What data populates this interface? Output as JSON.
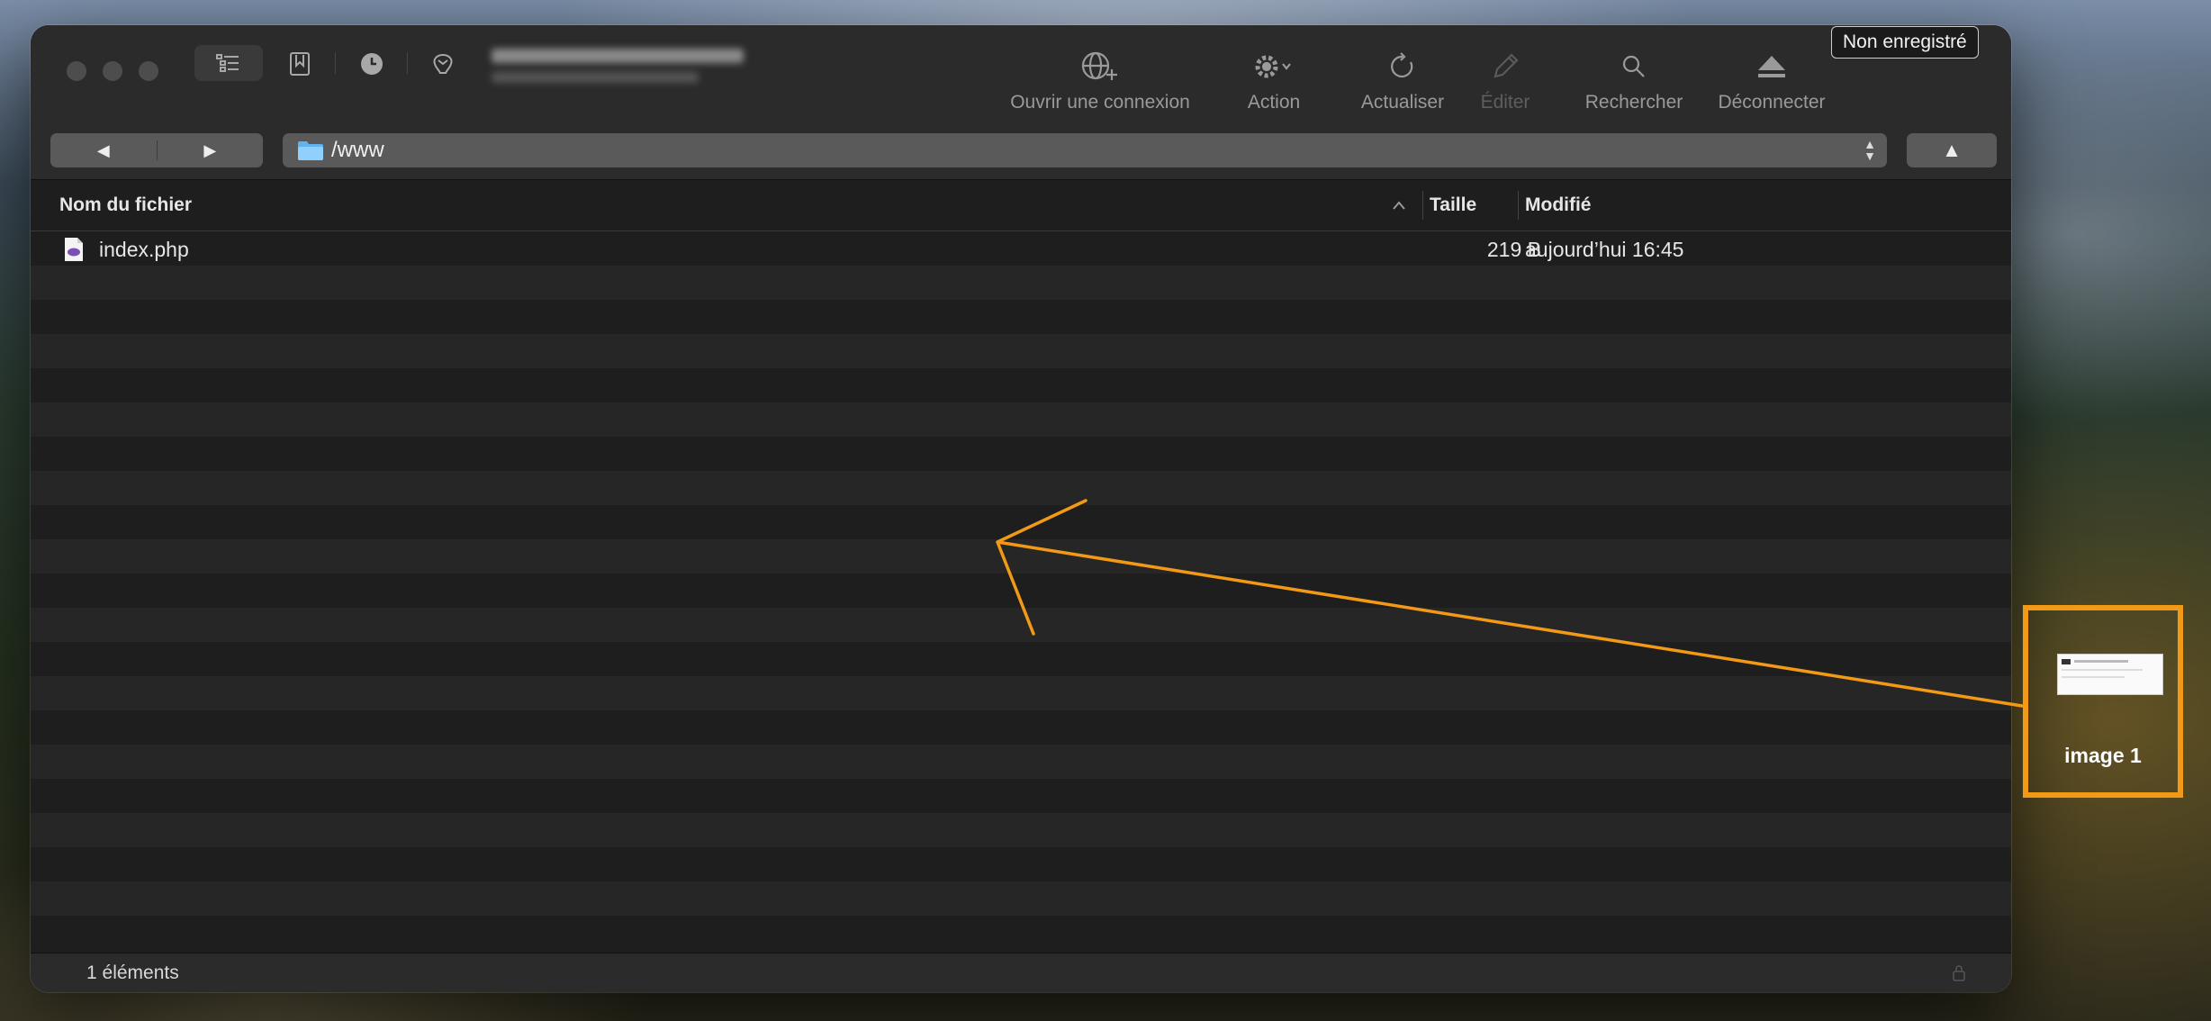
{
  "badge": {
    "label": "Non enregistré"
  },
  "toolbar": {
    "items": [
      {
        "label": "Ouvrir une connexion",
        "icon": "globe-plus-icon",
        "enabled": true
      },
      {
        "label": "Action",
        "icon": "gear-icon",
        "enabled": true
      },
      {
        "label": "Actualiser",
        "icon": "refresh-icon",
        "enabled": true
      },
      {
        "label": "Éditer",
        "icon": "pencil-icon",
        "enabled": false
      },
      {
        "label": "Rechercher",
        "icon": "search-icon",
        "enabled": true
      },
      {
        "label": "Déconnecter",
        "icon": "eject-icon",
        "enabled": true
      }
    ]
  },
  "nav": {
    "back": "◀",
    "forward": "▶",
    "up": "▲"
  },
  "path": {
    "value": "/www"
  },
  "columns": {
    "name": "Nom du fichier",
    "size": "Taille",
    "modified": "Modifié"
  },
  "files": [
    {
      "name": "index.php",
      "size": "219 B",
      "modified": "aujourd’hui 16:45",
      "icon": "php-file-icon"
    }
  ],
  "status": {
    "count_text": "1 éléments"
  },
  "drag_thumbnail": {
    "label": "image 1"
  },
  "colors": {
    "accent_orange": "#f29a16",
    "window_bg": "#1e1e1e",
    "toolbar_bg": "#2b2b2b"
  }
}
